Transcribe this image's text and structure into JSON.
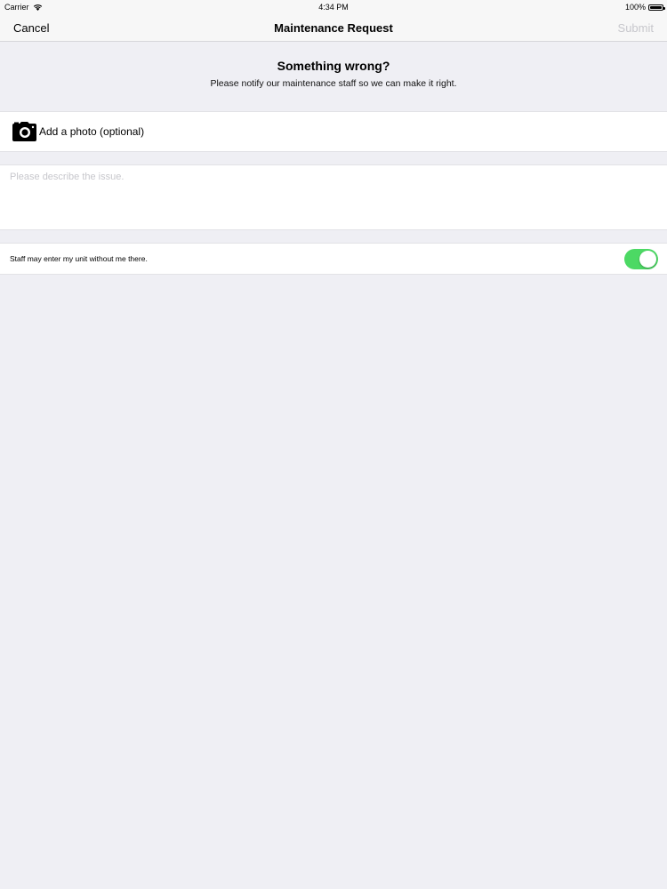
{
  "status_bar": {
    "carrier": "Carrier",
    "time": "4:34 PM",
    "battery_percent": "100%",
    "battery_level": 1.0,
    "wifi_icon": "wifi-icon",
    "battery_icon": "battery-icon"
  },
  "nav": {
    "cancel_label": "Cancel",
    "title": "Maintenance Request",
    "submit_label": "Submit"
  },
  "header": {
    "title": "Something wrong?",
    "subtitle": "Please notify our maintenance staff so we can make it right."
  },
  "photo": {
    "icon": "camera-icon",
    "label": "Add a photo (optional)"
  },
  "description": {
    "placeholder": "Please describe the issue.",
    "value": ""
  },
  "permission": {
    "label": "Staff may enter my unit without me there.",
    "toggle_on": true
  },
  "colors": {
    "background": "#efeff4",
    "toggle_on": "#4cd964",
    "submit_disabled": "#c7c7cc"
  }
}
